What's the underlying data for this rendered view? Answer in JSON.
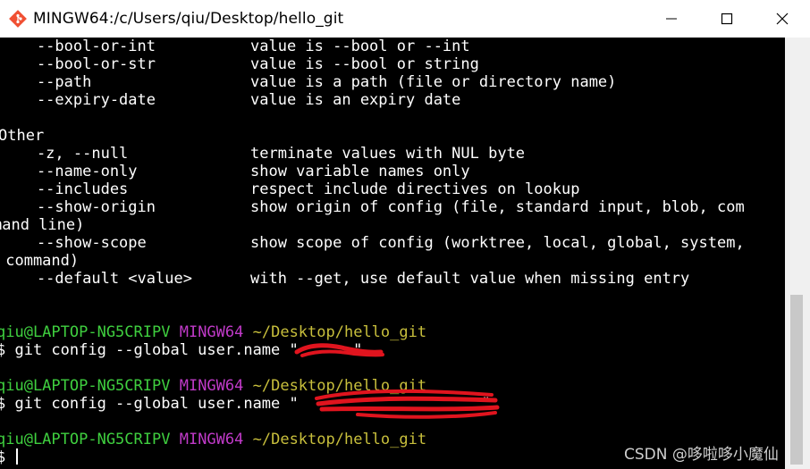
{
  "window": {
    "title": "MINGW64:/c/Users/qiu/Desktop/hello_git",
    "controls": {
      "minimize_icon": "minimize-icon",
      "maximize_icon": "maximize-icon",
      "close_icon": "close-icon"
    }
  },
  "terminal": {
    "lines": [
      {
        "opt": "    --bool-or-int",
        "desc": "value is --bool or --int"
      },
      {
        "opt": "    --bool-or-str",
        "desc": "value is --bool or string"
      },
      {
        "opt": "    --path",
        "desc": "value is a path (file or directory name)"
      },
      {
        "opt": "    --expiry-date",
        "desc": "value is an expiry date"
      },
      {
        "text": ""
      },
      {
        "text": "Other"
      },
      {
        "opt": "    -z, --null",
        "desc": "terminate values with NUL byte"
      },
      {
        "opt": "    --name-only",
        "desc": "show variable names only"
      },
      {
        "opt": "    --includes",
        "desc": "respect include directives on lookup"
      },
      {
        "opt": "    --show-origin",
        "desc": "show origin of config (file, standard input, blob, com"
      },
      {
        "text": "mand line)"
      },
      {
        "opt": "    --show-scope",
        "desc": "show scope of config (worktree, local, global, system,"
      },
      {
        "text": " command)"
      },
      {
        "opt": "    --default <value>",
        "desc": "with --get, use default value when missing entry"
      }
    ],
    "prompts": [
      {
        "user": "qiu@LAPTOP-NG5CRIPV",
        "shell": "MINGW64",
        "path": "~/Desktop/hello_git",
        "command": "$ git config --global user.name \"      \""
      },
      {
        "user": "qiu@LAPTOP-NG5CRIPV",
        "shell": "MINGW64",
        "path": "~/Desktop/hello_git",
        "command": "$ git config --global user.name \"                    \""
      },
      {
        "user": "qiu@LAPTOP-NG5CRIPV",
        "shell": "MINGW64",
        "path": "~/Desktop/hello_git",
        "command": "$ "
      }
    ]
  },
  "watermark": "CSDN @哆啦哆小魔仙",
  "colors": {
    "background": "#000000",
    "text": "#ffffff",
    "user": "#3fcf3f",
    "shell": "#c03ac8",
    "path": "#c8bf3c",
    "redaction": "#e0141e"
  }
}
